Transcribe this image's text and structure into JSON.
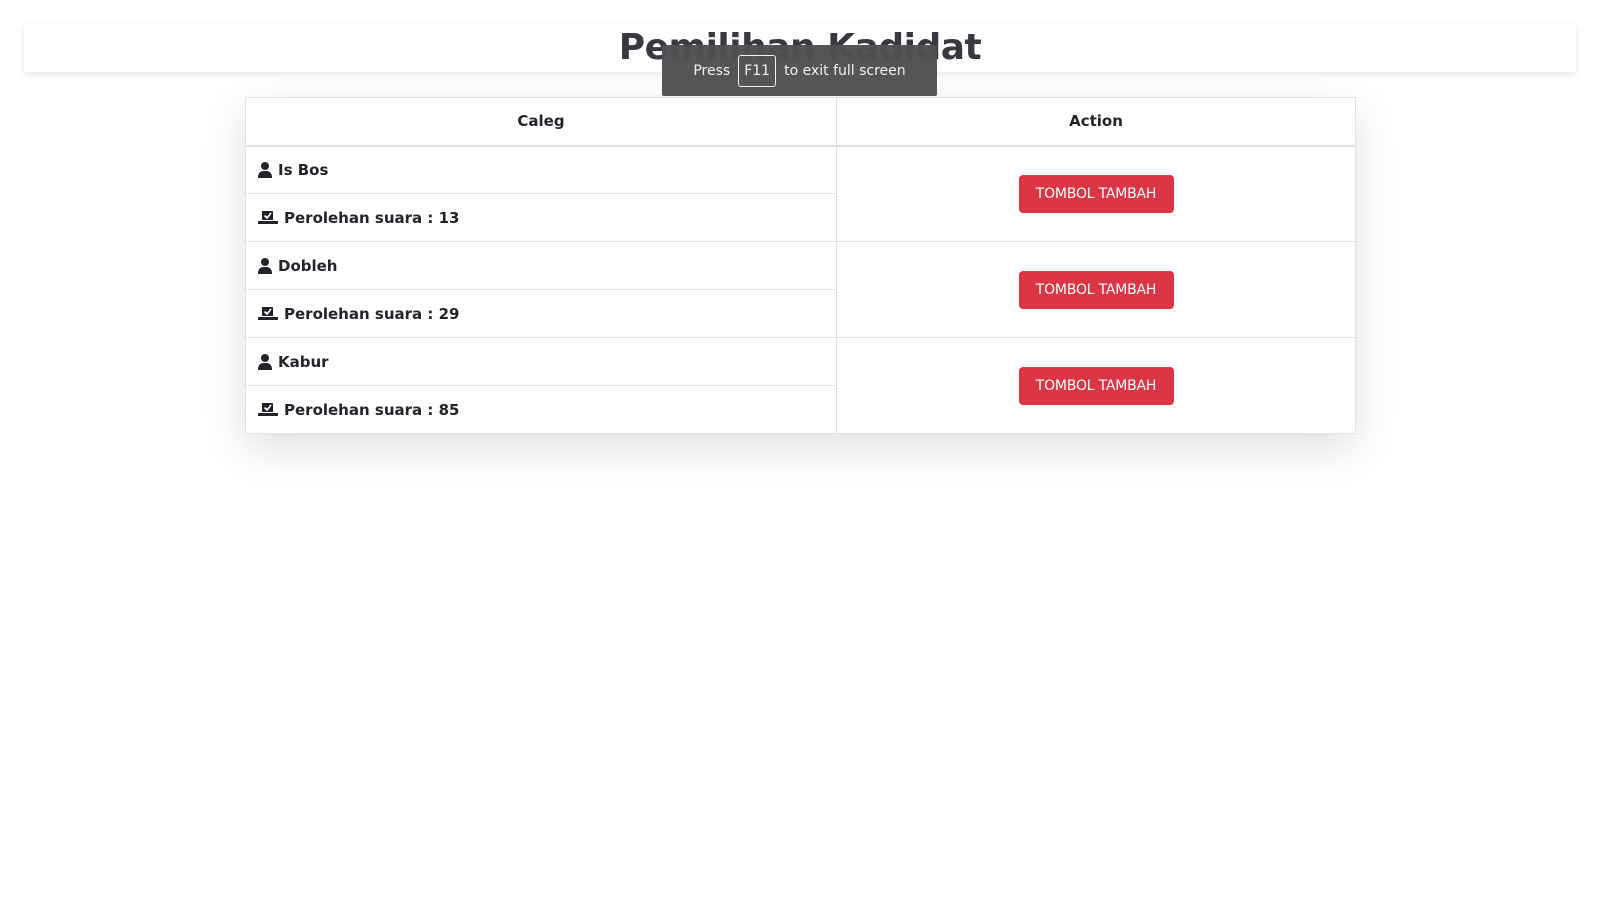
{
  "page": {
    "title": "Pemilihan Kadidat"
  },
  "fullscreen_toast": {
    "press": "Press",
    "key": "F11",
    "rest": "to exit full screen"
  },
  "table": {
    "headers": {
      "caleg": "Caleg",
      "action": "Action"
    },
    "rows": [
      {
        "name": "Is Bos",
        "votes": "Perolehan suara : 13",
        "button": "TOMBOL TAMBAH"
      },
      {
        "name": "Dobleh",
        "votes": "Perolehan suara : 29",
        "button": "TOMBOL TAMBAH"
      },
      {
        "name": "Kabur",
        "votes": "Perolehan suara : 85",
        "button": "TOMBOL TAMBAH"
      }
    ]
  },
  "icons": {
    "person": "person-icon",
    "vote": "vote-box-icon"
  },
  "colors": {
    "button": "#dc3545",
    "title": "#343a40",
    "toast_bg": "#4e5052"
  }
}
